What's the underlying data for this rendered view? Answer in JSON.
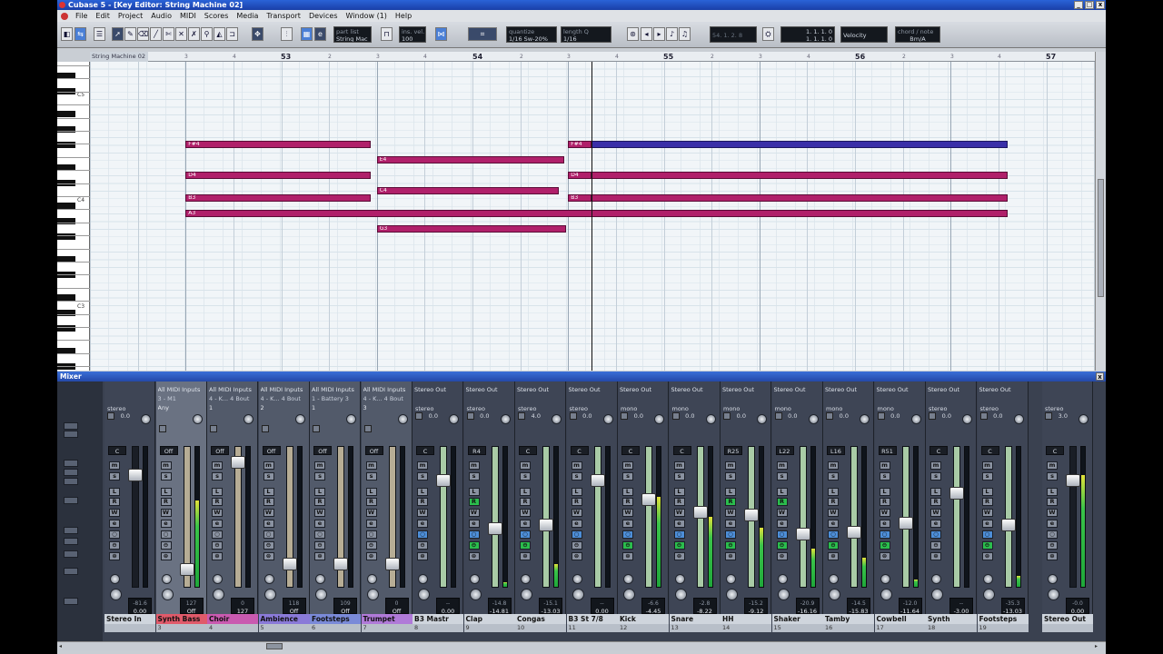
{
  "window": {
    "title": "Cubase 5 - [Key Editor: String Machine 02]",
    "buttons": [
      "_",
      "□",
      "x"
    ]
  },
  "menu": [
    "File",
    "Edit",
    "Project",
    "Audio",
    "MIDI",
    "Scores",
    "Media",
    "Transport",
    "Devices",
    "Window (1)",
    "Help"
  ],
  "toolbar": {
    "part_list_label": "part list",
    "part_list_value": "String Mac",
    "ins_vel_label": "ins. vel.",
    "ins_vel_value": "100",
    "quantize_label": "quantize",
    "quantize_value": "1/16 Sw-20%",
    "length_label": "length Q",
    "length_value": "1/16",
    "position_value": "54. 1. 2. 8",
    "pos1": "1. 1. 1. 0",
    "pos2": "1. 1. 1. 0",
    "controller_value": "Velocity",
    "chord_label": "chord / note",
    "chord_value": "Bm/A"
  },
  "ruler": {
    "clip_name": "String Machine 02",
    "bars": [
      "53",
      "54",
      "55",
      "56",
      "57"
    ],
    "beats": [
      "3",
      "4",
      "2",
      "3",
      "4",
      "2",
      "3",
      "4",
      "2",
      "3",
      "4",
      "2",
      "3",
      "4"
    ]
  },
  "keys": {
    "labels": [
      "C5",
      "C4",
      "C3"
    ]
  },
  "notes": [
    {
      "pitch": "F#4",
      "start": 53.0,
      "end": 53.97
    },
    {
      "pitch": "D4",
      "start": 53.0,
      "end": 53.97
    },
    {
      "pitch": "B3",
      "start": 53.0,
      "end": 53.97
    },
    {
      "pitch": "A3",
      "start": 53.0,
      "end": 57.3
    },
    {
      "pitch": "E4",
      "start": 54.0,
      "end": 54.98
    },
    {
      "pitch": "C4",
      "start": 54.0,
      "end": 54.95
    },
    {
      "pitch": "G3",
      "start": 54.0,
      "end": 54.99
    },
    {
      "pitch": "F#4",
      "start": 55.0,
      "end": 55.12
    },
    {
      "pitch": "",
      "start": 55.12,
      "end": 57.3,
      "selected": true
    },
    {
      "pitch": "D4",
      "start": 55.0,
      "end": 55.12
    },
    {
      "pitch": "",
      "start": 55.12,
      "end": 57.3
    },
    {
      "pitch": "B3",
      "start": 55.0,
      "end": 55.12
    },
    {
      "pitch": "",
      "start": 55.12,
      "end": 57.3
    }
  ],
  "playhead_position": 55.12,
  "mixer": {
    "title": "Mixer",
    "close_label": "x",
    "channels": [
      {
        "name": "Stereo In",
        "number": "",
        "type": "input",
        "routing": [
          "",
          "",
          ""
        ],
        "pan": "C",
        "chk": "stereo",
        "gain": "0.0",
        "vol": "0.00",
        "peak": "-81.6",
        "meter": 0,
        "fader": 0.18,
        "color": "#cfd5dd"
      },
      {
        "name": "Synth Bass",
        "number": "3",
        "type": "midi",
        "routing": [
          "All MIDI Inputs",
          "3 - M1",
          "Any"
        ],
        "pan": "Off",
        "chk": "",
        "gain": "",
        "vol": "Off",
        "peak": "127",
        "meter": 0.62,
        "fader": 0.92,
        "sel": true,
        "color": "#e05a6a"
      },
      {
        "name": "Choir",
        "number": "4",
        "type": "midi",
        "routing": [
          "All MIDI Inputs",
          "4 - K... 4 Bout",
          "1"
        ],
        "pan": "Off",
        "chk": "",
        "gain": "",
        "vol": "127",
        "peak": "0",
        "meter": 0,
        "fader": 0.08,
        "color": "#c95ab0"
      },
      {
        "name": "Ambience",
        "number": "5",
        "type": "midi",
        "routing": [
          "All MIDI Inputs",
          "4 - K... 4 Bout",
          "2"
        ],
        "pan": "Off",
        "chk": "",
        "gain": "",
        "vol": "Off",
        "peak": "118",
        "meter": 0,
        "fader": 0.88,
        "color": "#8a7ad8"
      },
      {
        "name": "Footsteps",
        "number": "6",
        "type": "midi",
        "routing": [
          "All MIDI Inputs",
          "1 - Battery 3",
          "1"
        ],
        "pan": "Off",
        "chk": "",
        "gain": "",
        "vol": "Off",
        "peak": "109",
        "meter": 0,
        "fader": 0.88,
        "color": "#7a8ad8"
      },
      {
        "name": "Trumpet",
        "number": "7",
        "type": "midi",
        "routing": [
          "All MIDI Inputs",
          "4 - K... 4 Bout",
          "3"
        ],
        "pan": "Off",
        "chk": "",
        "gain": "",
        "vol": "Off",
        "peak": "0",
        "meter": 0,
        "fader": 0.88,
        "color": "#b07ad8"
      },
      {
        "name": "B3 Mastr",
        "number": "8",
        "type": "audio",
        "routing": [
          "Stereo Out",
          "",
          ""
        ],
        "pan": "C",
        "chk": "stereo",
        "gain": "0.0",
        "vol": "0.00",
        "peak": "--",
        "meter": 0,
        "fader": 0.22,
        "color": "#cfd5dd"
      },
      {
        "name": "Clap",
        "number": "9",
        "type": "audio",
        "routing": [
          "Stereo Out",
          "",
          ""
        ],
        "pan": "R4",
        "chk": "stereo",
        "gain": "0.0",
        "vol": "-14.81",
        "peak": "-14.8",
        "meter": 0.03,
        "fader": 0.6,
        "color": "#cfd5dd"
      },
      {
        "name": "Congas",
        "number": "10",
        "type": "audio",
        "routing": [
          "Stereo Out",
          "",
          ""
        ],
        "pan": "C",
        "chk": "stereo",
        "gain": "4.0",
        "vol": "-13.03",
        "peak": "-15.1",
        "meter": 0.16,
        "fader": 0.57,
        "color": "#cfd5dd"
      },
      {
        "name": "B3 St 7/8",
        "number": "11",
        "type": "audio",
        "routing": [
          "Stereo Out",
          "",
          ""
        ],
        "pan": "C",
        "chk": "stereo",
        "gain": "0.0",
        "vol": "0.00",
        "peak": "--",
        "meter": 0,
        "fader": 0.22,
        "color": "#cfd5dd"
      },
      {
        "name": "Kick",
        "number": "12",
        "type": "audio",
        "routing": [
          "Stereo Out",
          "",
          ""
        ],
        "pan": "C",
        "chk": "mono",
        "gain": "0.0",
        "vol": "-4.45",
        "peak": "-6.6",
        "meter": 0.64,
        "fader": 0.37,
        "color": "#cfd5dd"
      },
      {
        "name": "Snare",
        "number": "13",
        "type": "audio",
        "routing": [
          "Stereo Out",
          "",
          ""
        ],
        "pan": "C",
        "chk": "mono",
        "gain": "0.0",
        "vol": "-8.22",
        "peak": "-2.8",
        "meter": 0.5,
        "fader": 0.47,
        "color": "#cfd5dd"
      },
      {
        "name": "HH",
        "number": "14",
        "type": "audio",
        "routing": [
          "Stereo Out",
          "",
          ""
        ],
        "pan": "R25",
        "chk": "mono",
        "gain": "0.0",
        "vol": "-9.12",
        "peak": "-15.2",
        "meter": 0.42,
        "fader": 0.49,
        "color": "#cfd5dd"
      },
      {
        "name": "Shaker",
        "number": "15",
        "type": "audio",
        "routing": [
          "Stereo Out",
          "",
          ""
        ],
        "pan": "L22",
        "chk": "mono",
        "gain": "0.0",
        "vol": "-16.16",
        "peak": "-20.9",
        "meter": 0.27,
        "fader": 0.64,
        "color": "#cfd5dd"
      },
      {
        "name": "Tamby",
        "number": "16",
        "type": "audio",
        "routing": [
          "Stereo Out",
          "",
          ""
        ],
        "pan": "L16",
        "chk": "mono",
        "gain": "0.0",
        "vol": "-15.83",
        "peak": "-14.5",
        "meter": 0.21,
        "fader": 0.63,
        "color": "#cfd5dd"
      },
      {
        "name": "Cowbell",
        "number": "17",
        "type": "audio",
        "routing": [
          "Stereo Out",
          "",
          ""
        ],
        "pan": "R51",
        "chk": "mono",
        "gain": "0.0",
        "vol": "-11.64",
        "peak": "-12.0",
        "meter": 0.05,
        "fader": 0.56,
        "color": "#cfd5dd"
      },
      {
        "name": "Synth",
        "number": "18",
        "type": "audio",
        "routing": [
          "Stereo Out",
          "",
          ""
        ],
        "pan": "C",
        "chk": "stereo",
        "gain": "0.0",
        "vol": "-3.00",
        "peak": "--",
        "meter": 0,
        "fader": 0.32,
        "color": "#cfd5dd"
      },
      {
        "name": "Footsteps",
        "number": "19",
        "type": "audio",
        "routing": [
          "Stereo Out",
          "",
          ""
        ],
        "pan": "C",
        "chk": "stereo",
        "gain": "0.0",
        "vol": "-13.03",
        "peak": "-35.3",
        "meter": 0.08,
        "fader": 0.57,
        "color": "#cfd5dd"
      },
      {
        "name": "Stereo Out",
        "number": "",
        "type": "output",
        "routing": [
          "",
          "",
          ""
        ],
        "pan": "C",
        "chk": "stereo",
        "gain": "3.0",
        "vol": "0.00",
        "peak": "-0.0",
        "meter": 0.8,
        "fader": 0.22,
        "color": "#cfd5dd"
      }
    ]
  },
  "colors": {
    "note": "#b0206a",
    "note_selected": "#3a2fa8",
    "meter_green": "#1fa83a",
    "button_on": "#2bbd4d"
  }
}
